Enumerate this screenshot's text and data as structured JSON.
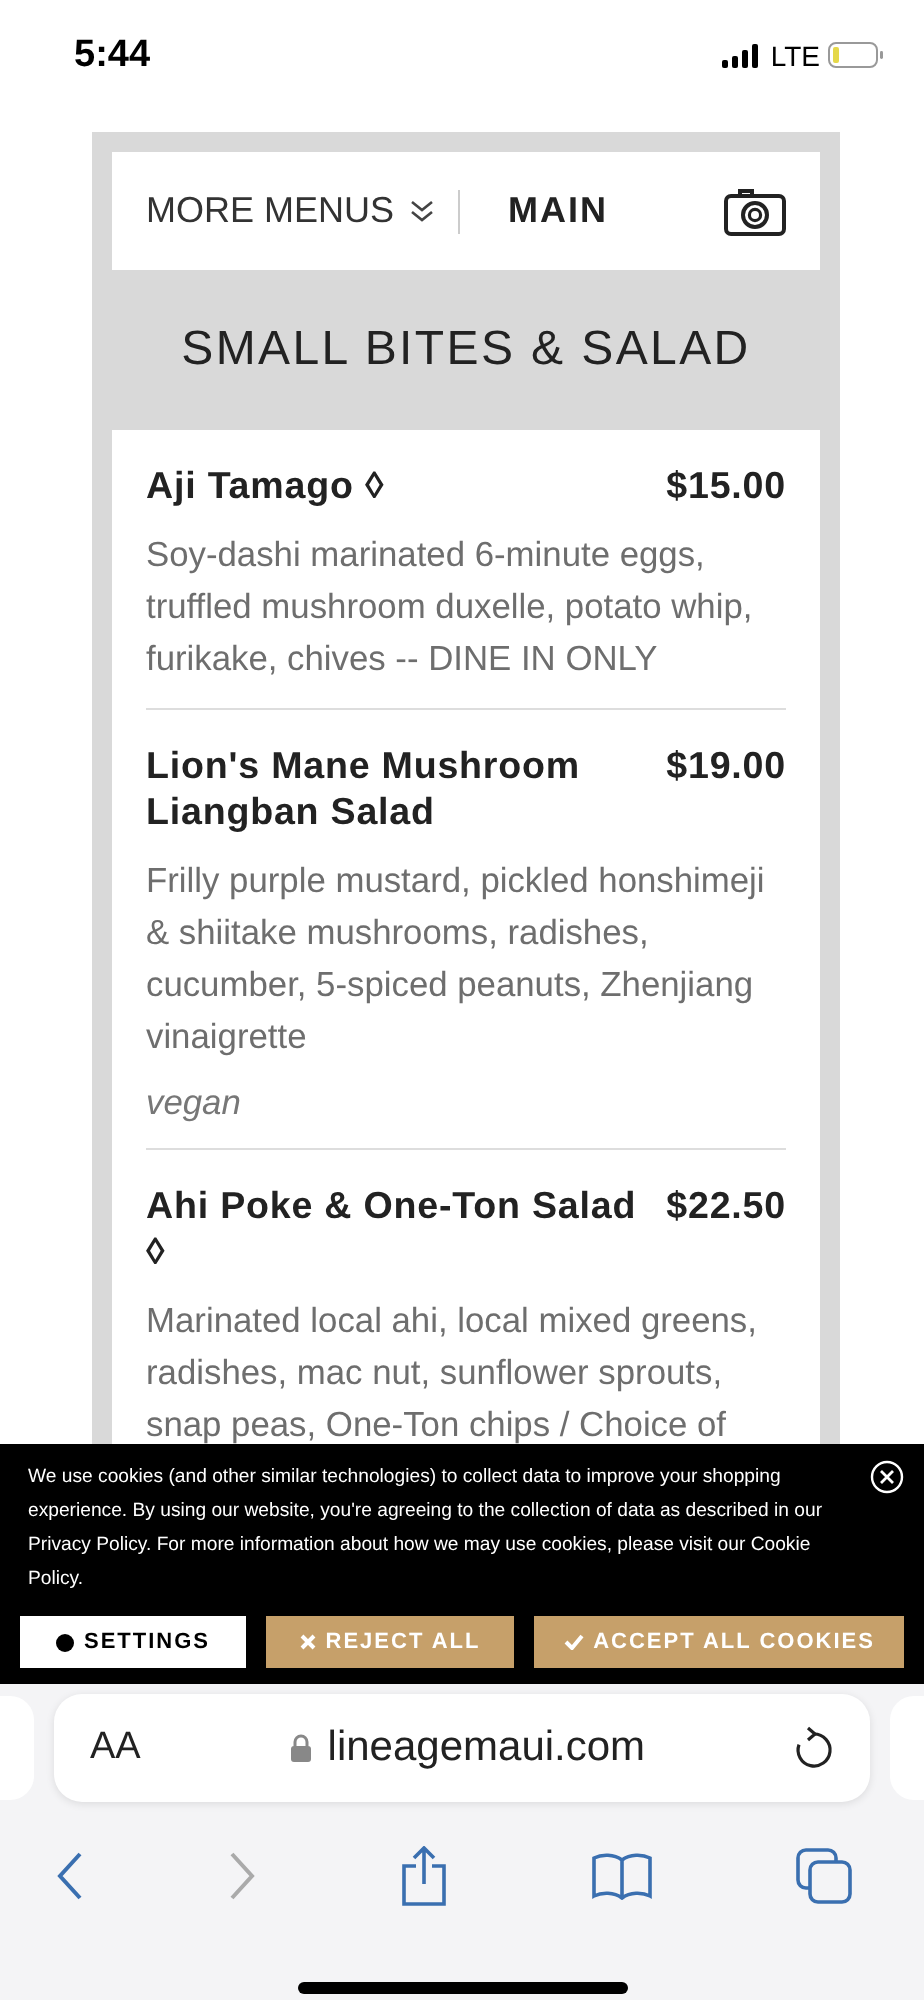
{
  "status_bar": {
    "time": "5:44",
    "network": "LTE"
  },
  "menu_nav": {
    "more_menus": "MORE MENUS",
    "current_menu": "MAIN"
  },
  "section": {
    "title": "SMALL BITES & SALAD",
    "items": [
      {
        "name": "Aji Tamago ◊",
        "price": "$15.00",
        "description": "Soy-dashi marinated 6-minute eggs, truffled mushroom duxelle, potato whip, furikake, chives -- DINE IN ONLY"
      },
      {
        "name": "Lion's Mane Mushroom Liangban Salad",
        "price": "$19.00",
        "description": "Frilly purple mustard, pickled honshimeji & shiitake mushrooms, radishes, cucumber, 5-spiced peanuts, Zhenjiang vinaigrette",
        "note": "vegan"
      },
      {
        "name": "Ahi Poke & One-Ton Salad ◊",
        "price": "$22.50",
        "description": "Marinated local ahi, local mixed greens, radishes, mac nut, sunflower sprouts, snap peas, One-Ton chips / Choice of"
      }
    ]
  },
  "cookie_banner": {
    "message": "We use cookies (and other similar technologies) to collect data to improve your shopping experience. By using our website, you're agreeing to the collection of data as described in our Privacy Policy. For more information about how we may use cookies, please visit our Cookie Policy.",
    "buttons": [
      {
        "kind": "settings",
        "label": "SETTINGS"
      },
      {
        "kind": "reject",
        "label": "REJECT ALL"
      },
      {
        "kind": "accept",
        "label": "ACCEPT ALL COOKIES"
      }
    ]
  },
  "browser": {
    "text_size": "AA",
    "url": "lineagemaui.com"
  }
}
